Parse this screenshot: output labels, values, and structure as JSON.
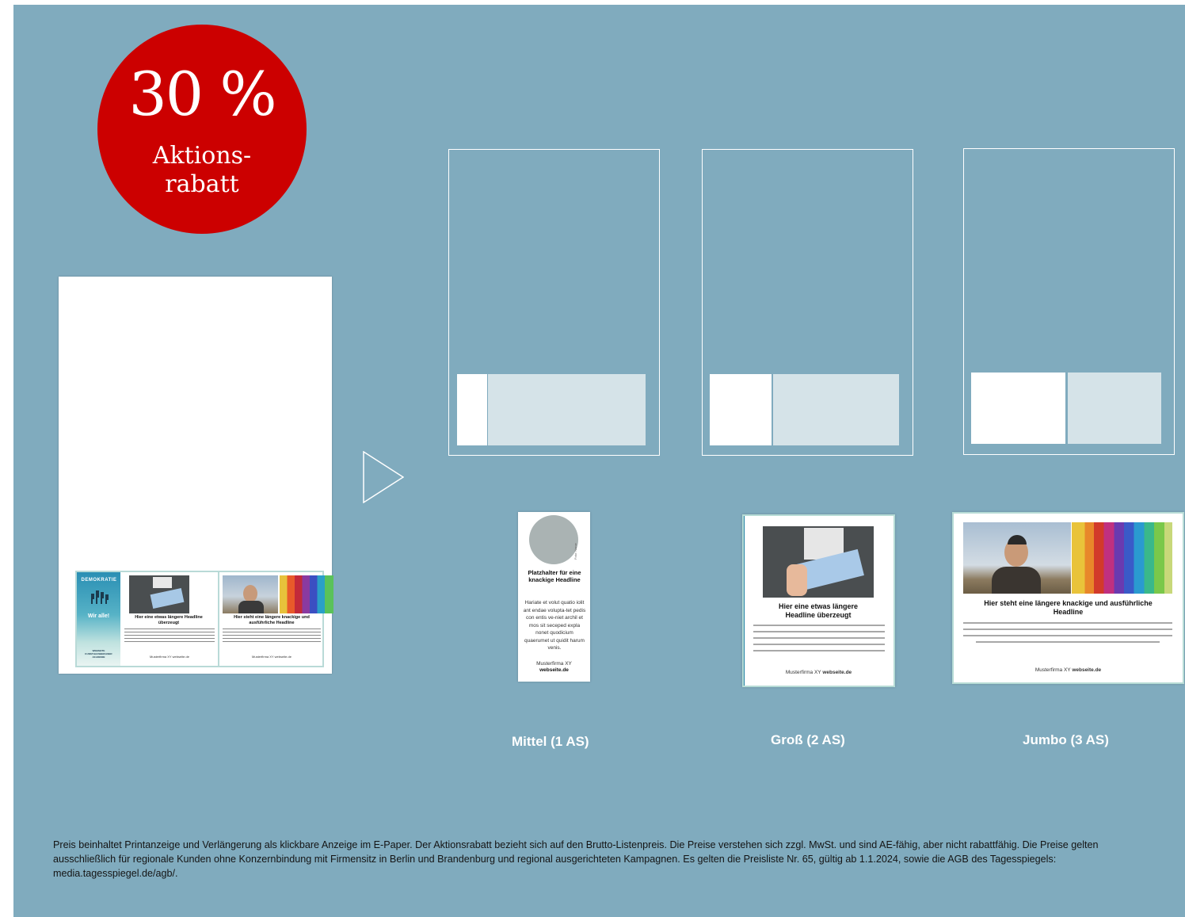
{
  "badge": {
    "percent": "30 %",
    "line1": "Aktions-",
    "line2": "rabatt"
  },
  "mini_ad": {
    "demo": "DEMOKRATIE",
    "wir": "Wir alle!",
    "org": "WEBSEITE KUNSTHAUSBERLINER AKADEMIE",
    "col1_headline": "Hier eine etwas längere Headline überzeugt",
    "col1_footer": "Musterfirma XY webseite.de",
    "col2_headline": "Hier steht eine längere knackige und ausführliche Headline",
    "col2_footer": "Musterfirma XY webseite.de"
  },
  "ads": {
    "mittel": {
      "photo_credit": "Foto: Name",
      "headline": "Platzhalter für eine knackige Headline",
      "body": "Hariate et volut quatio iolit ant endae volupta-tet pedis con entis ve-niet archil et mos sit seceped expla nonet quodicium quaerumet ut quidit harum venis.",
      "company": "Musterfirma XY",
      "website": "webseite.de"
    },
    "gross": {
      "headline": "Hier eine etwas längere Headline überzeugt",
      "footer_company": "Musterfirma XY",
      "footer_site": "webseite.de"
    },
    "jumbo": {
      "headline": "Hier steht eine längere knackige und ausführliche Headline",
      "footer_company": "Musterfirma XY",
      "footer_site": "webseite.de"
    }
  },
  "captions": {
    "mittel": "Mittel (1 AS)",
    "gross": "Groß (2 AS)",
    "jumbo": "Jumbo (3 AS)"
  },
  "footnote": "Preis beinhaltet Printanzeige und Verlängerung als klickbare Anzeige im E-Paper. Der Aktionsrabatt bezieht sich auf den Brutto-Listenpreis. Die Preise verstehen sich zzgl. MwSt. und sind AE-fähig, aber nicht rabattfähig. Die Preise gelten ausschließlich für regionale Kunden ohne Konzernbindung mit Firmensitz in Berlin und Brandenburg und regional ausgerichteten Kampagnen. Es gelten die Preisliste Nr. 65, gültig ab 1.1.2024, sowie die AGB des Tagesspiegels: media.tagesspiegel.de/agb/.",
  "colors": {
    "background": "#80abbe",
    "badge": "#cc0000",
    "slot_fill": "#d5e3e8",
    "ad_border": "#b7dcd6"
  }
}
